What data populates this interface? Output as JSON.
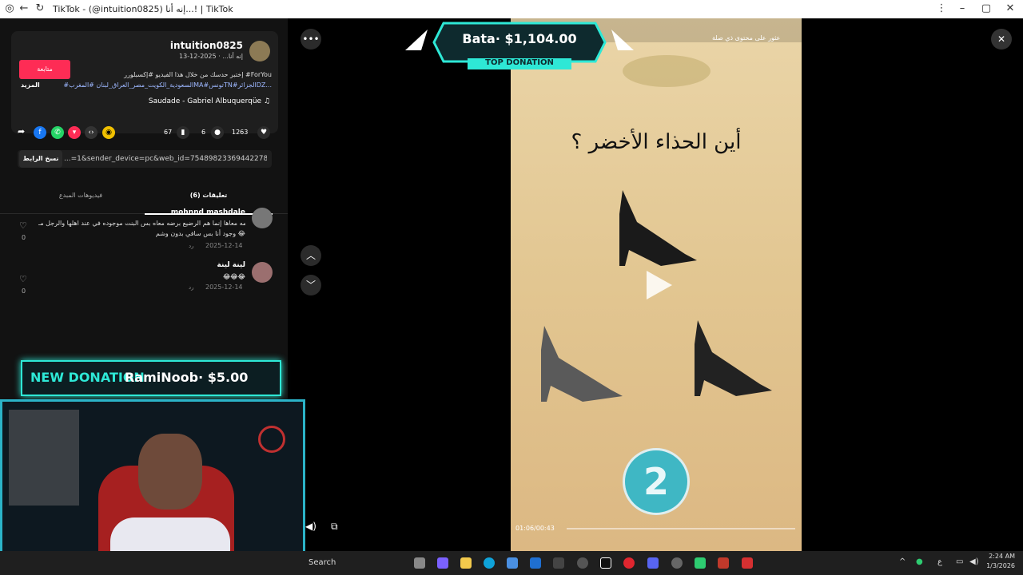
{
  "window": {
    "title": "TikTok - (@intuition0825) إنه أنا...! | TikTok"
  },
  "post": {
    "username": "intuition0825",
    "meta": "إنه أنا... · 2025-12-13",
    "follow_label": "متابعة",
    "caption_line1": "إختبر حدسك من خلال هذا الفيديو #إكسبلورر #ForYou",
    "caption_line2": "#السعودية_الكويت_مصر_العراق_لبنان #المغربMA#تونسTN#الجزائرDZ...",
    "more_label": "المزيد",
    "music": "Saudade - Gabriel Albuquerqüe ♫",
    "likes": "1263",
    "comments_count": "6",
    "saves": "67",
    "link_value": "...=1&sender_device=pc&web_id=7548982336944227896",
    "copy_link_label": "نسخ الرابط",
    "tab_comments": "تعليقات (6)",
    "tab_creator_videos": "فيديوهات المبدع"
  },
  "comments": [
    {
      "user": "mohnnd mashdale",
      "text": "قم الجرمه معاها إنما هم الرضيع برضه معاه بس البنت موجوده في عند اهلها والرجل مـ",
      "text2": "وجود أنا بس سافي بدون وشم 😂",
      "date": "2025-12-14",
      "reply": "رد",
      "likes": "0"
    },
    {
      "user": "لينة لينة",
      "text": "😂😂😂",
      "text2": "",
      "date": "2025-12-14",
      "reply": "رد",
      "likes": "0"
    }
  ],
  "video": {
    "question": "أين الحذاء الأخضر ؟",
    "related_label": "عثور على محتوى ذي صلة",
    "time": "01:06/00:43",
    "countdown": "2"
  },
  "overlays": {
    "top_donation_amount": "Bata· $1,104.00",
    "top_donation_label": "TOP DONATION",
    "new_donation_label": "NEW DONATION",
    "new_donation_text": "RamiNoob· $5.00"
  },
  "taskbar": {
    "search": "Search",
    "time": "2:24 AM",
    "date": "1/3/2026",
    "lang": "ع"
  }
}
